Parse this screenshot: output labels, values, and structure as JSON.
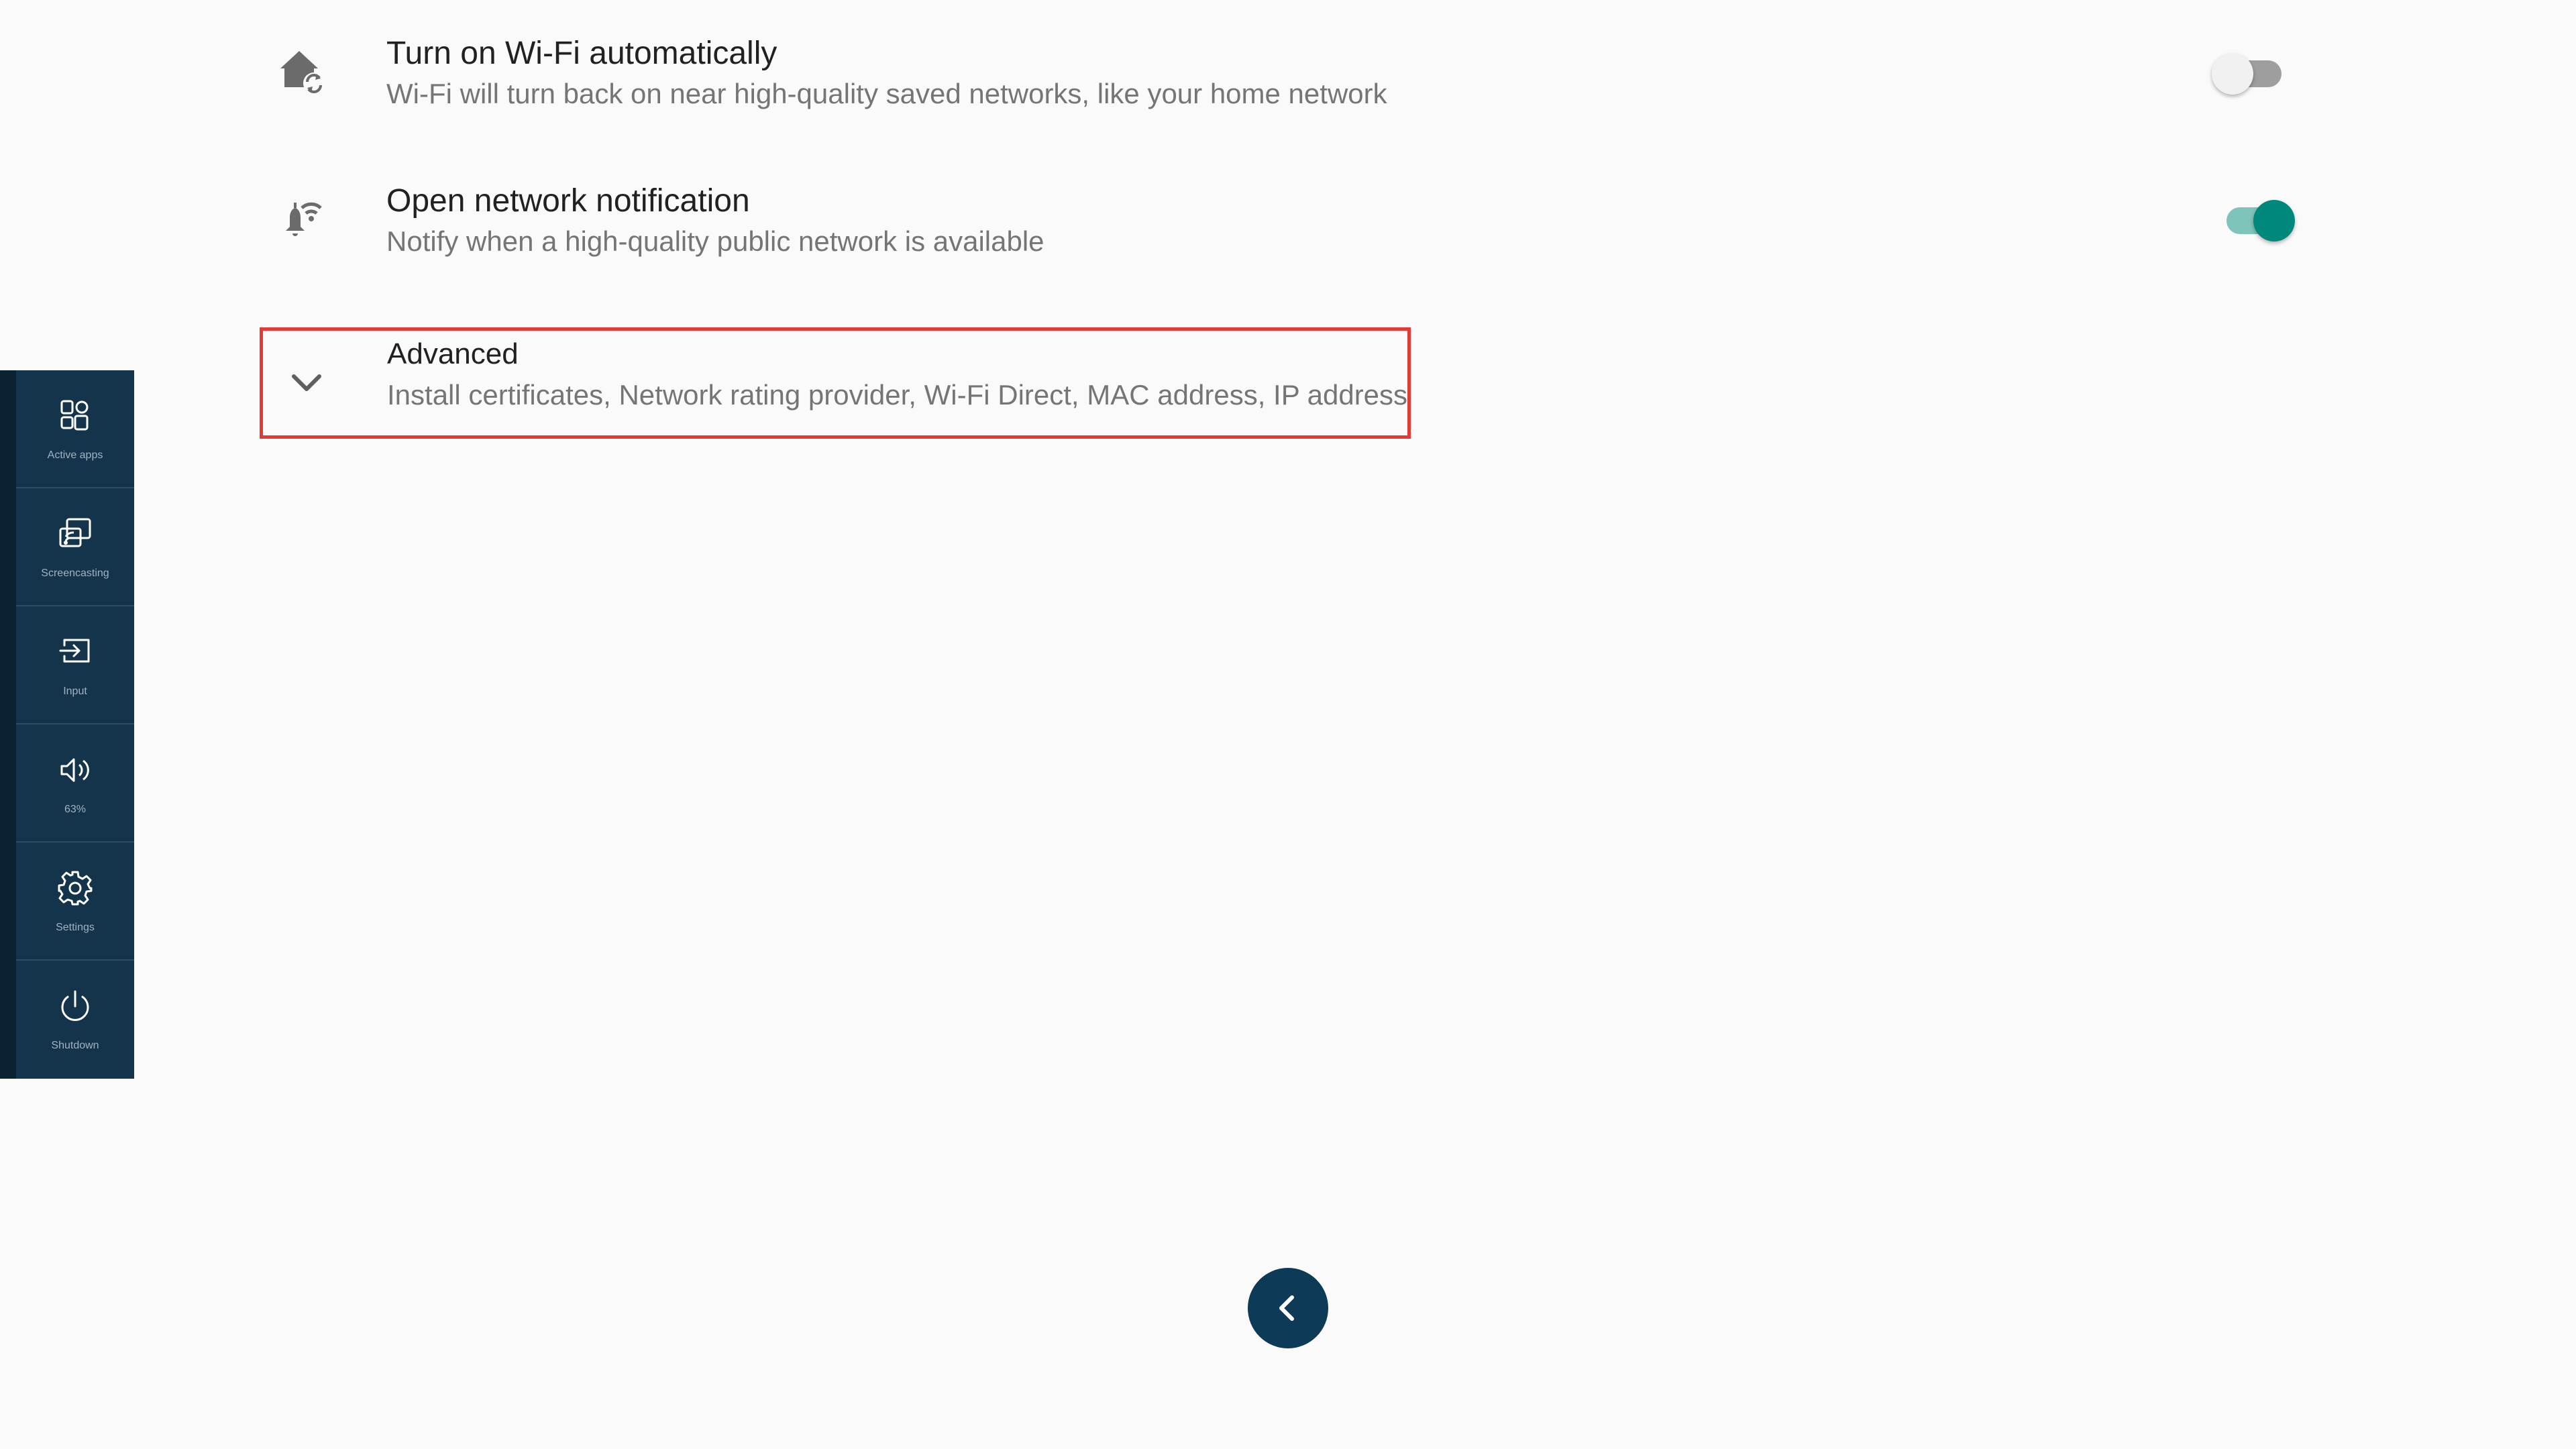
{
  "settings": {
    "wifi_auto": {
      "title": "Turn on Wi-Fi automatically",
      "subtitle": "Wi-Fi will turn back on near high-quality saved networks, like your home network",
      "icon": "home-sync-icon",
      "enabled": false
    },
    "open_network": {
      "title": "Open network notification",
      "subtitle": "Notify when a high-quality public network is available",
      "icon": "wifi-notification-bell-icon",
      "enabled": true
    },
    "advanced": {
      "title": "Advanced",
      "subtitle": "Install certificates, Network rating provider, Wi-Fi Direct, MAC address, IP address",
      "icon": "chevron-down-icon"
    }
  },
  "dock": {
    "items": [
      {
        "label": "Active apps",
        "icon": "active-apps-icon"
      },
      {
        "label": "Screencasting",
        "icon": "screencasting-icon"
      },
      {
        "label": "Input",
        "icon": "input-icon"
      },
      {
        "label": "63%",
        "icon": "volume-icon"
      },
      {
        "label": "Settings",
        "icon": "gear-icon"
      },
      {
        "label": "Shutdown",
        "icon": "power-icon"
      }
    ]
  },
  "back_button": {
    "icon": "chevron-left-icon"
  },
  "colors": {
    "background": "#fafafa",
    "dock": "#13344a",
    "accent": "#00897b",
    "highlight": "#e53935",
    "back_button": "#0d3a57"
  }
}
